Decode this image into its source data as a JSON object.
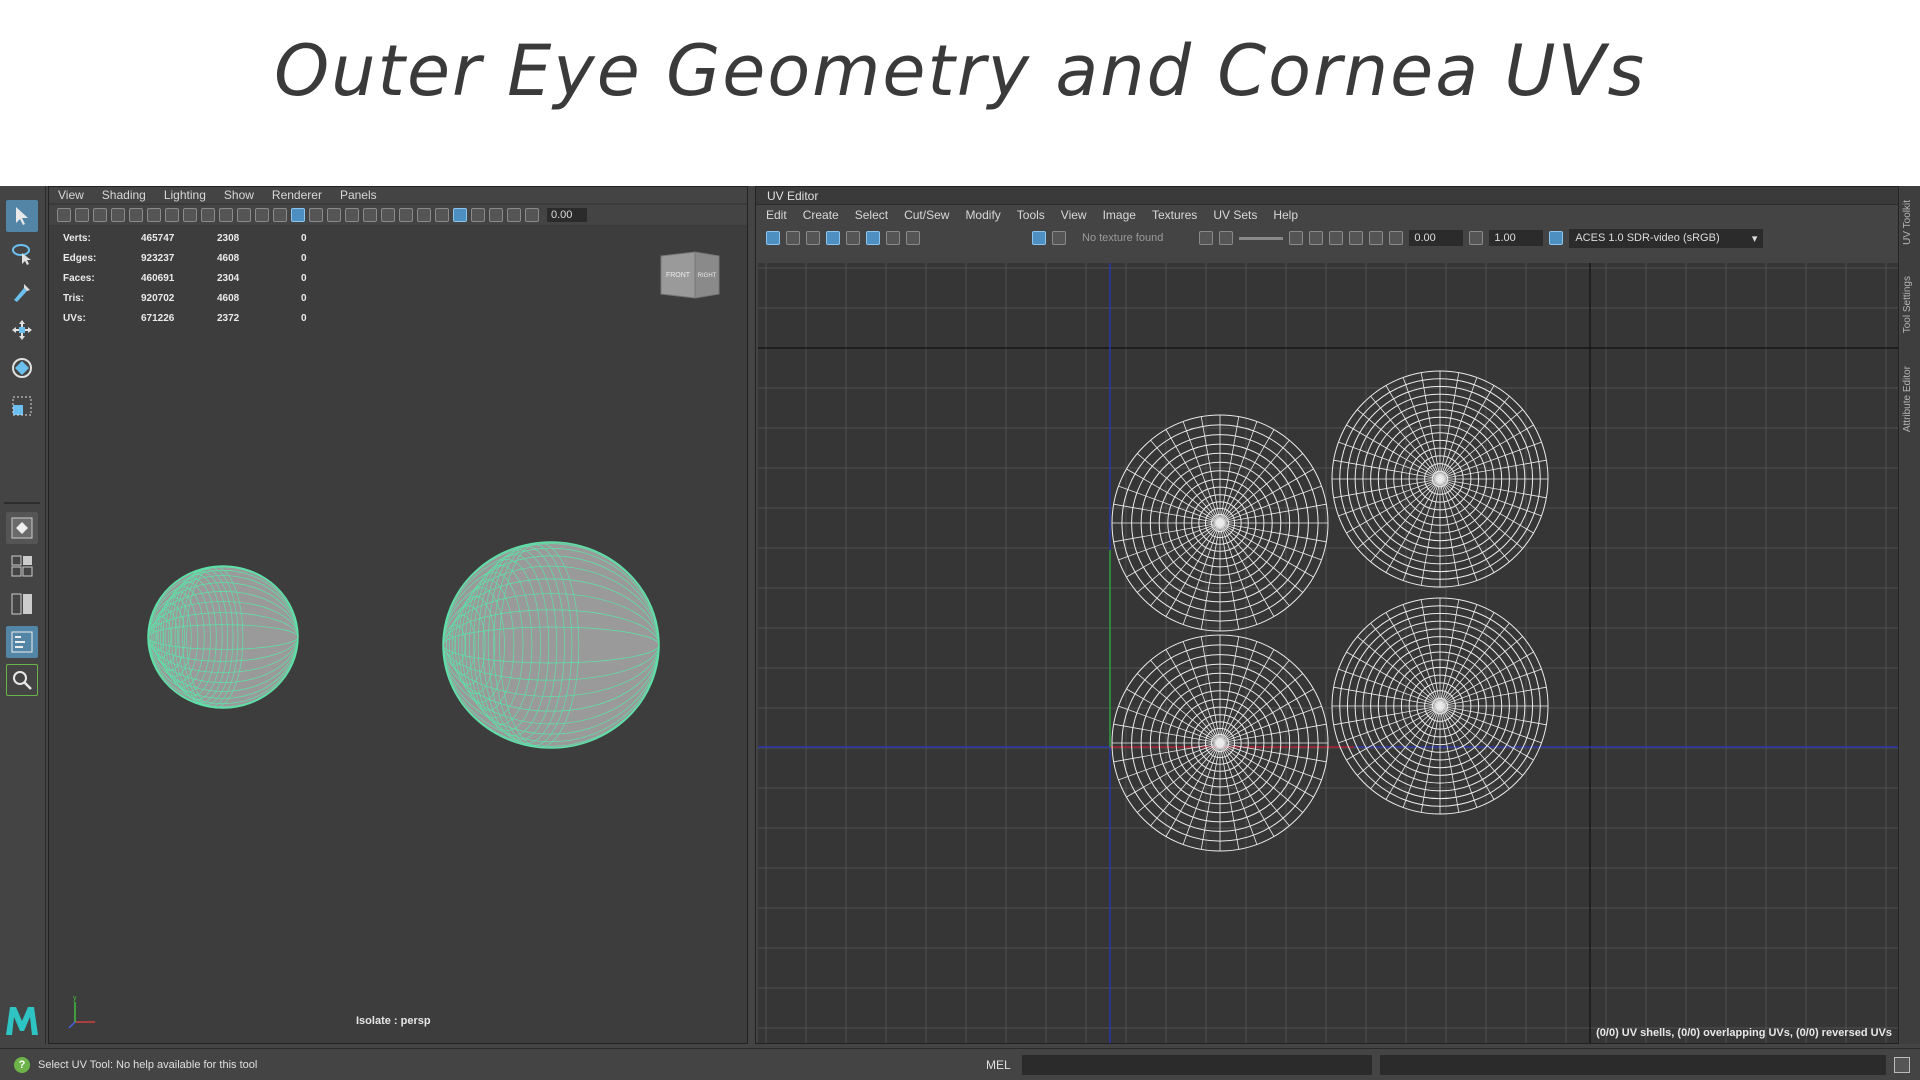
{
  "slide": {
    "title": "Outer Eye Geometry and Cornea UVs"
  },
  "viewport": {
    "menu": [
      "View",
      "Shading",
      "Lighting",
      "Show",
      "Renderer",
      "Panels"
    ],
    "exposure": "0.00",
    "hud": [
      {
        "label": "Verts:",
        "a": "465747",
        "b": "2308",
        "c": "0"
      },
      {
        "label": "Edges:",
        "a": "923237",
        "b": "4608",
        "c": "0"
      },
      {
        "label": "Faces:",
        "a": "460691",
        "b": "2304",
        "c": "0"
      },
      {
        "label": "Tris:",
        "a": "920702",
        "b": "4608",
        "c": "0"
      },
      {
        "label": "UVs:",
        "a": "671226",
        "b": "2372",
        "c": "0"
      }
    ],
    "viewcube": {
      "front": "FRONT",
      "right": "RIGHT"
    },
    "isolate": "Isolate : persp",
    "colors": {
      "wire": "#5fe0a8",
      "shade": "#9a9a9a"
    }
  },
  "uv_editor": {
    "title": "UV Editor",
    "menu": [
      "Edit",
      "Create",
      "Select",
      "Cut/Sew",
      "Modify",
      "Tools",
      "View",
      "Image",
      "Textures",
      "UV Sets",
      "Help"
    ],
    "texture_status": "No texture found",
    "exposure": "0.00",
    "gamma": "1.00",
    "color_space": "ACES 1.0 SDR-video (sRGB)",
    "status": "(0/0) UV shells, (0/0) overlapping UVs, (0/0) reversed UVs"
  },
  "side_tabs": [
    "UV Toolkit",
    "Tool Settings",
    "Attribute Editor"
  ],
  "statusbar": {
    "help": "Select UV Tool: No help available for this tool",
    "mel": "MEL"
  },
  "toolbox_icons": [
    "select-tool-icon",
    "lasso-tool-icon",
    "paint-select-icon",
    "move-tool-icon",
    "rotate-tool-icon",
    "scale-tool-icon"
  ]
}
